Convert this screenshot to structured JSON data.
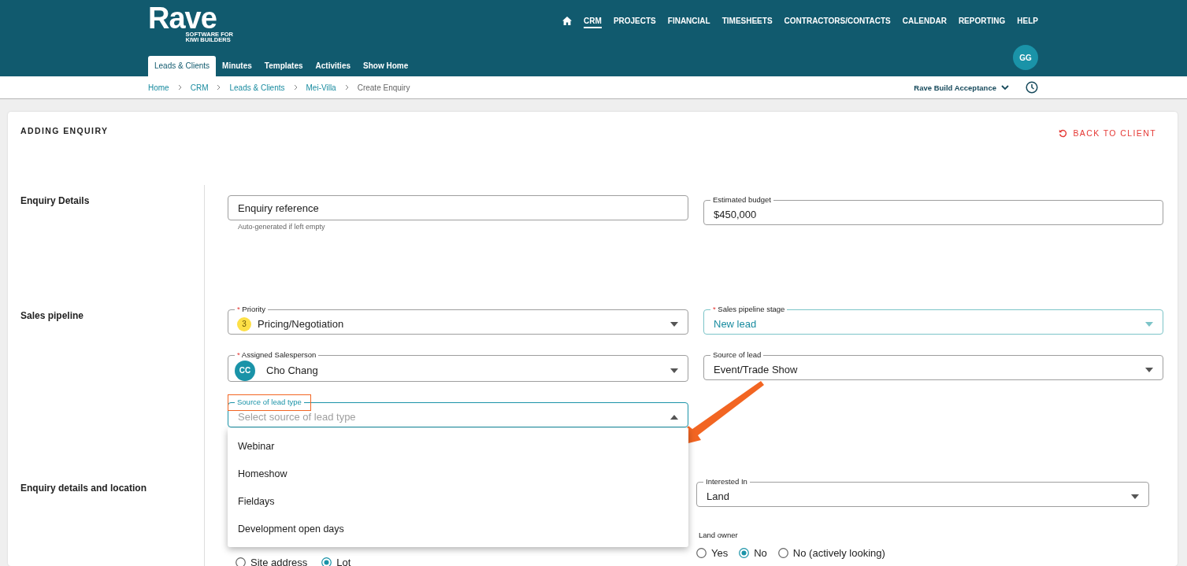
{
  "header": {
    "logo": "Rave",
    "tagline": [
      "SOFTWARE FOR",
      "KIWI BUILDERS"
    ],
    "nav": [
      {
        "kind": "home",
        "selected": false
      },
      {
        "kind": "link",
        "label": "CRM",
        "selected": true
      },
      {
        "kind": "link",
        "label": "PROJECTS",
        "selected": false
      },
      {
        "kind": "link",
        "label": "FINANCIAL",
        "selected": false
      },
      {
        "kind": "link",
        "label": "TIMESHEETS",
        "selected": false
      },
      {
        "kind": "link",
        "label": "CONTRACTORS/CONTACTS",
        "selected": false
      },
      {
        "kind": "link",
        "label": "CALENDAR",
        "selected": false
      },
      {
        "kind": "link",
        "label": "REPORTING",
        "selected": false
      },
      {
        "kind": "link",
        "label": "HELP",
        "selected": false
      }
    ],
    "tabs": [
      {
        "label": "Leads & Clients",
        "selected": true
      },
      {
        "label": "Minutes",
        "selected": false
      },
      {
        "label": "Templates",
        "selected": false
      },
      {
        "label": "Activities",
        "selected": false
      },
      {
        "label": "Show Home",
        "selected": false
      }
    ],
    "user_avatar": "GG"
  },
  "breadcrumbs": [
    {
      "label": "Home",
      "current": false
    },
    {
      "label": "CRM",
      "current": false
    },
    {
      "label": "Leads & Clients",
      "current": false
    },
    {
      "label": "Mei-Villa",
      "current": false
    },
    {
      "label": "Create Enquiry",
      "current": true
    }
  ],
  "workspace_switcher": {
    "label": "Rave Build Acceptance"
  },
  "card": {
    "title": "ADDING ENQUIRY",
    "back_link": "BACK TO CLIENT"
  },
  "sections": [
    {
      "title": "Enquiry Details",
      "left": [
        {
          "kind": "text",
          "label": "Enquiry reference",
          "helper": "Auto-generated if left empty"
        }
      ],
      "right": [
        {
          "kind": "text",
          "label": "Estimated budget",
          "value": "$450,000"
        }
      ]
    },
    {
      "title": "Sales pipeline",
      "left": [
        {
          "kind": "select",
          "label": "Priority",
          "required_mark": "*",
          "badge": "3",
          "value": "Pricing/Negotiation",
          "open": false,
          "highlighted": false
        },
        {
          "kind": "select",
          "label": "Assigned Salesperson",
          "required_mark": "*",
          "avatar": "CC",
          "value": "Cho Chang",
          "open": false,
          "highlighted": false
        },
        {
          "kind": "select",
          "label": "Source of lead type",
          "placeholder": "Select source of lead type",
          "open": true,
          "highlighted": true,
          "options": [
            "Webinar",
            "Homeshow",
            "Fieldays",
            "Development open days"
          ]
        }
      ],
      "right": [
        {
          "kind": "select",
          "label": "Sales pipeline stage",
          "required_mark": "*",
          "value": "New lead",
          "open": false,
          "highlighted": true
        },
        {
          "kind": "select",
          "label": "Source of lead",
          "value": "Event/Trade Show",
          "open": false,
          "highlighted": false
        }
      ]
    },
    {
      "title": "Enquiry details and location",
      "left": [
        {
          "kind": "radio_group",
          "options": [
            {
              "label": "Site address",
              "selected": false
            },
            {
              "label": "Lot",
              "selected": true
            }
          ]
        }
      ],
      "right": [
        {
          "kind": "select",
          "label": "Interested In",
          "value": "Land",
          "open": false,
          "highlighted": false
        },
        {
          "kind": "radio_group",
          "label": "Land owner",
          "options": [
            {
              "label": "Yes",
              "selected": false
            },
            {
              "label": "No",
              "selected": true
            },
            {
              "label": "No (actively looking)",
              "selected": false
            }
          ]
        }
      ]
    }
  ]
}
